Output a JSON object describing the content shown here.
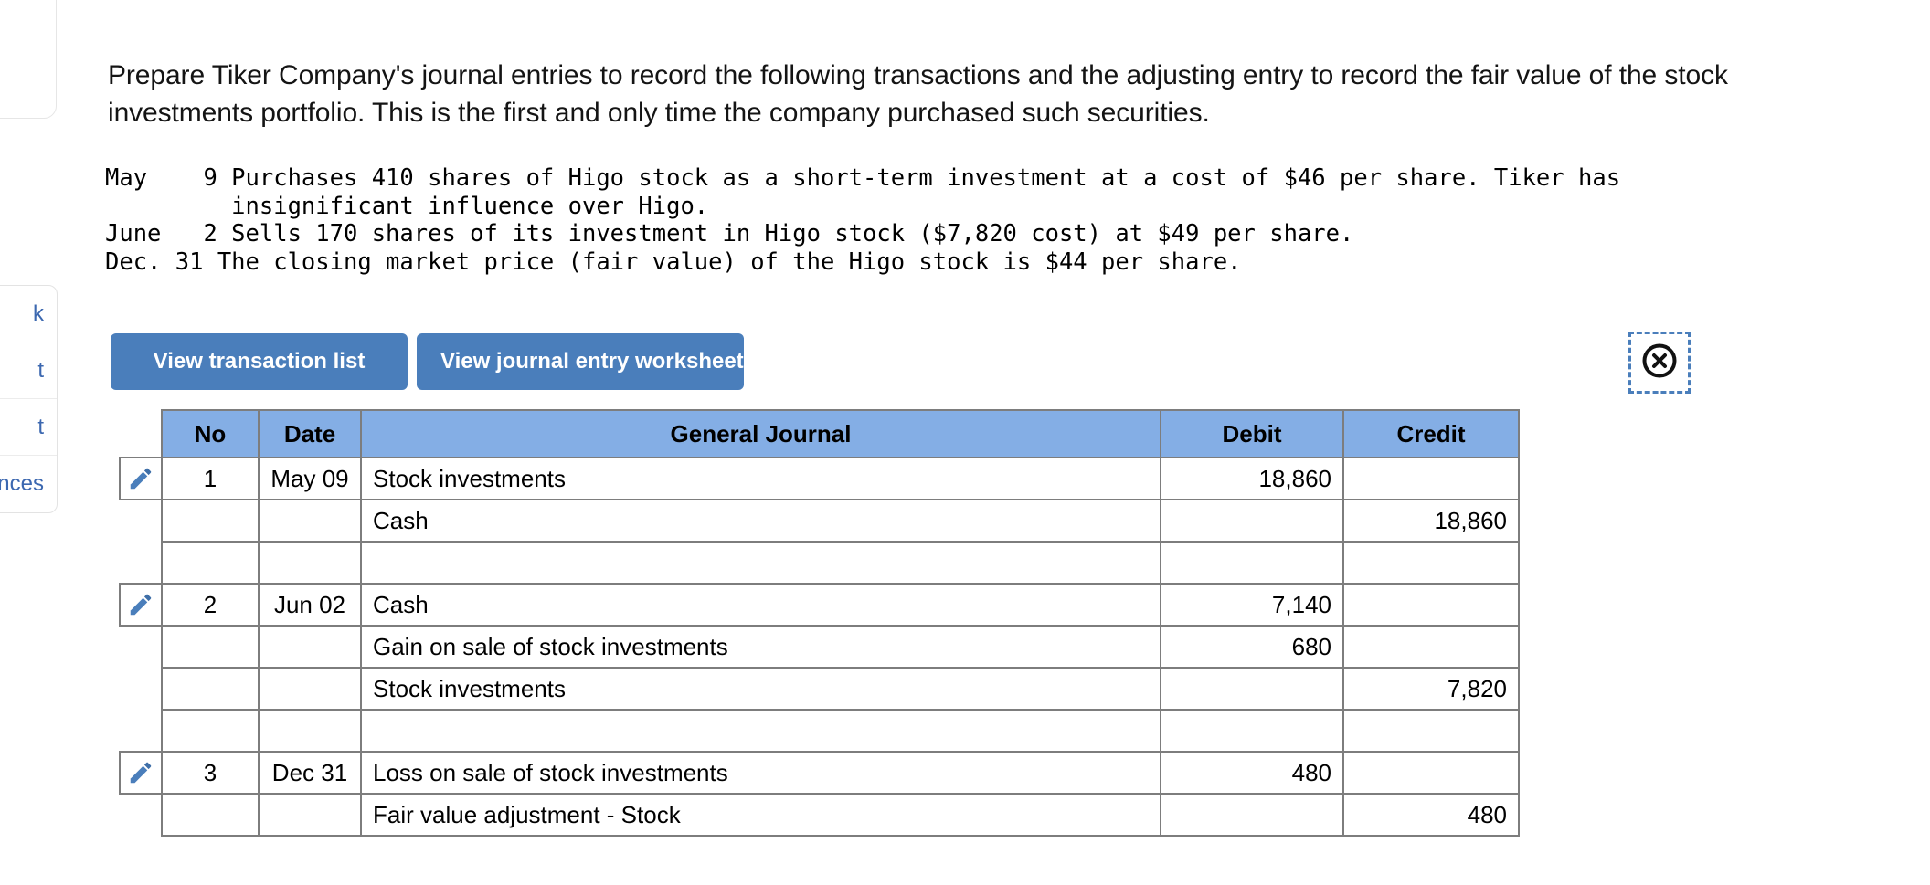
{
  "left_panel": {
    "menu_items": [
      {
        "label": "k"
      },
      {
        "label": "t"
      },
      {
        "label": "t"
      },
      {
        "label": "nces"
      }
    ]
  },
  "prompt": {
    "text": "Prepare Tiker Company's journal entries to record the following transactions and the adjusting entry to record the fair value of the stock investments portfolio. This is the first and only time the company purchased such securities."
  },
  "transactions": {
    "text": "May    9 Purchases 410 shares of Higo stock as a short-term investment at a cost of $46 per share. Tiker has\n         insignificant influence over Higo.\nJune   2 Sells 170 shares of its investment in Higo stock ($7,820 cost) at $49 per share.\nDec. 31 The closing market price (fair value) of the Higo stock is $44 per share."
  },
  "toolbar": {
    "view_transaction_list_label": "View transaction list",
    "view_journal_worksheet_label": "View journal entry worksheet",
    "close_icon_name": "close-circle-icon",
    "button_color": "#4a7ebb",
    "selection_outline_color": "#4a7ebb"
  },
  "journal_table": {
    "header_color": "#84aee5",
    "border_color": "#7d7d7d",
    "columns": [
      {
        "key": "no",
        "label": "No"
      },
      {
        "key": "date",
        "label": "Date"
      },
      {
        "key": "general_journal",
        "label": "General Journal"
      },
      {
        "key": "debit",
        "label": "Debit"
      },
      {
        "key": "credit",
        "label": "Credit"
      }
    ],
    "rows": [
      {
        "edit": true,
        "no": "1",
        "date": "May 09",
        "account": "Stock investments",
        "indent": false,
        "debit": "18,860",
        "credit": ""
      },
      {
        "edit": false,
        "no": "",
        "date": "",
        "account": "Cash",
        "indent": true,
        "debit": "",
        "credit": "18,860"
      },
      {
        "edit": false,
        "no": "",
        "date": "",
        "account": "",
        "indent": false,
        "debit": "",
        "credit": ""
      },
      {
        "edit": true,
        "no": "2",
        "date": "Jun 02",
        "account": "Cash",
        "indent": false,
        "debit": "7,140",
        "credit": ""
      },
      {
        "edit": false,
        "no": "",
        "date": "",
        "account": "Gain on sale of stock investments",
        "indent": false,
        "debit": "680",
        "credit": ""
      },
      {
        "edit": false,
        "no": "",
        "date": "",
        "account": "Stock investments",
        "indent": true,
        "debit": "",
        "credit": "7,820"
      },
      {
        "edit": false,
        "no": "",
        "date": "",
        "account": "",
        "indent": false,
        "debit": "",
        "credit": ""
      },
      {
        "edit": true,
        "no": "3",
        "date": "Dec 31",
        "account": "Loss on sale of stock investments",
        "indent": false,
        "debit": "480",
        "credit": ""
      },
      {
        "edit": false,
        "no": "",
        "date": "",
        "account": "Fair value adjustment - Stock",
        "indent": true,
        "debit": "",
        "credit": "480"
      }
    ]
  }
}
